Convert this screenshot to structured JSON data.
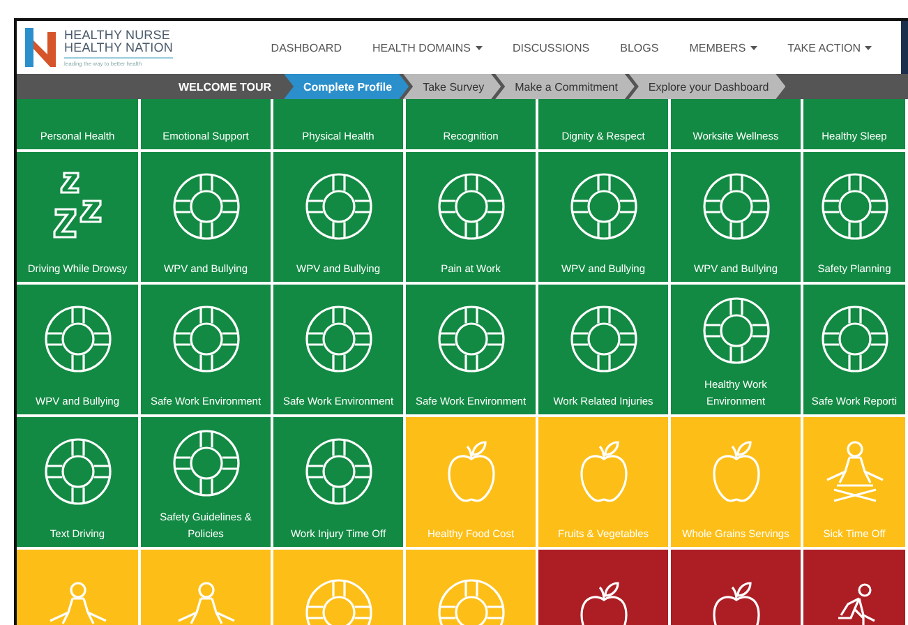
{
  "brand": {
    "line_1": "HEALTHY NURSE",
    "line_2": "HEALTHY NATION",
    "tagline": "leading the way to better health"
  },
  "nav": [
    {
      "label": "DASHBOARD",
      "dropdown": false
    },
    {
      "label": "HEALTH DOMAINS",
      "dropdown": true
    },
    {
      "label": "DISCUSSIONS",
      "dropdown": false
    },
    {
      "label": "BLOGS",
      "dropdown": false
    },
    {
      "label": "MEMBERS",
      "dropdown": true
    },
    {
      "label": "TAKE ACTION",
      "dropdown": true
    }
  ],
  "tour": {
    "title": "WELCOME TOUR",
    "steps": [
      {
        "label": "Complete Profile",
        "selected": true
      },
      {
        "label": "Take Survey",
        "selected": false
      },
      {
        "label": "Make a Commitment",
        "selected": false
      },
      {
        "label": "Explore your Dashboard",
        "selected": false
      }
    ]
  },
  "tiles": [
    {
      "label": "Personal Health",
      "color": "#128a43"
    },
    {
      "label": "Emotional Support",
      "color": "#128a43"
    },
    {
      "label": "Physical Health",
      "color": "#128a43"
    },
    {
      "label": "Recognition",
      "color": "#128a43"
    },
    {
      "label": "Dignity & Respect",
      "color": "#128a43"
    },
    {
      "label": "Worksite Wellness",
      "color": "#128a43"
    },
    {
      "label": "Healthy Sleep",
      "color": "#128a43"
    },
    {
      "label": "Driving While Drowsy",
      "color": "#128a43",
      "kind": "sleep"
    },
    {
      "label": "WPV and Bullying",
      "color": "#128a43",
      "kind": "lifebuoy"
    },
    {
      "label": "WPV and Bullying",
      "color": "#128a43",
      "kind": "lifebuoy"
    },
    {
      "label": "Pain at Work",
      "color": "#128a43",
      "kind": "lifebuoy"
    },
    {
      "label": "WPV and Bullying",
      "color": "#128a43",
      "kind": "lifebuoy"
    },
    {
      "label": "WPV and Bullying",
      "color": "#128a43",
      "kind": "lifebuoy"
    },
    {
      "label": "Safety Planning",
      "color": "#128a43",
      "kind": "lifebuoy"
    },
    {
      "label": "WPV and Bullying",
      "color": "#128a43",
      "kind": "lifebuoy"
    },
    {
      "label": "Safe Work Environment",
      "color": "#128a43",
      "kind": "lifebuoy"
    },
    {
      "label": "Safe Work Environment",
      "color": "#128a43",
      "kind": "lifebuoy"
    },
    {
      "label": "Safe Work Environment",
      "color": "#128a43",
      "kind": "lifebuoy"
    },
    {
      "label": "Work Related Injuries",
      "color": "#128a43",
      "kind": "lifebuoy"
    },
    {
      "label": "Healthy Work Environment",
      "color": "#128a43",
      "kind": "lifebuoy"
    },
    {
      "label": "Safe Work Reporti",
      "color": "#128a43",
      "kind": "lifebuoy"
    },
    {
      "label": "Text Driving",
      "color": "#128a43",
      "kind": "lifebuoy"
    },
    {
      "label": "Safety Guidelines & Policies",
      "color": "#128a43",
      "kind": "lifebuoy"
    },
    {
      "label": "Work Injury Time Off",
      "color": "#128a43",
      "kind": "lifebuoy"
    },
    {
      "label": "Healthy Food Cost",
      "color": "#fdbf17",
      "kind": "apple"
    },
    {
      "label": "Fruits & Vegetables",
      "color": "#fdbf17",
      "kind": "apple"
    },
    {
      "label": "Whole Grains Servings",
      "color": "#fdbf17",
      "kind": "apple"
    },
    {
      "label": "Sick Time Off",
      "color": "#fdbf17",
      "kind": "meditation"
    },
    {
      "color": "#fdbf17",
      "kind": "meditation"
    },
    {
      "color": "#fdbf17",
      "kind": "meditation"
    },
    {
      "color": "#fdbf17",
      "kind": "lifebuoy"
    },
    {
      "color": "#fdbf17",
      "kind": "lifebuoy"
    },
    {
      "color": "#ac1d24",
      "kind": "apple"
    },
    {
      "color": "#ac1d24",
      "kind": "apple"
    },
    {
      "color": "#ac1d24",
      "kind": "runner"
    }
  ]
}
